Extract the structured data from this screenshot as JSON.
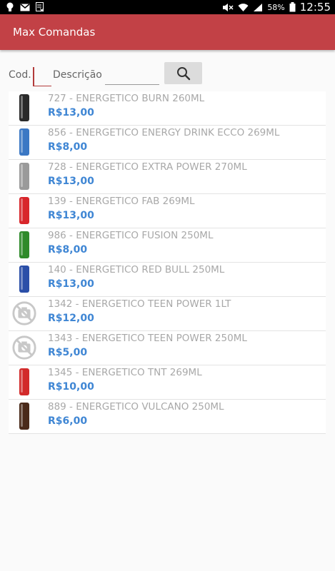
{
  "status_bar": {
    "time": "12:55",
    "battery_percent": "58%",
    "left_icons": [
      "lightbulb-icon",
      "mail-icon",
      "ocr-icon"
    ],
    "right_icons": [
      "mute-icon",
      "wifi-icon",
      "signal-icon",
      "battery-icon"
    ]
  },
  "app_bar": {
    "title": "Max Comandas",
    "color": "#c24146"
  },
  "filters": {
    "cod_label": "Cod.",
    "cod_value": "",
    "desc_label": "Descrição",
    "desc_value": "",
    "search_icon": "search-icon"
  },
  "products": [
    {
      "title": "727 - ENERGETICO BURN 260ML",
      "price": "R$13,00",
      "image": "can",
      "can_color": "#2a2a2a"
    },
    {
      "title": "856 - ENERGETICO ENERGY DRINK ECCO 269ML",
      "price": "R$8,00",
      "image": "can",
      "can_color": "#3b78c4"
    },
    {
      "title": "728 - ENERGETICO EXTRA POWER 270ML",
      "price": "R$13,00",
      "image": "can",
      "can_color": "#9a9a9a"
    },
    {
      "title": "139 - ENERGETICO FAB 269ML",
      "price": "R$13,00",
      "image": "can",
      "can_color": "#d8262b"
    },
    {
      "title": "986 - ENERGETICO FUSION 250ML",
      "price": "R$8,00",
      "image": "can",
      "can_color": "#2f8a2a"
    },
    {
      "title": "140 - ENERGETICO RED BULL 250ML",
      "price": "R$13,00",
      "image": "can",
      "can_color": "#2b4fa8"
    },
    {
      "title": "1342 - ENERGETICO TEEN POWER 1LT",
      "price": "R$12,00",
      "image": "no-photo"
    },
    {
      "title": "1343 - ENERGETICO TEEN POWER 250ML",
      "price": "R$5,00",
      "image": "no-photo"
    },
    {
      "title": "1345 - ENERGETICO TNT 269ML",
      "price": "R$10,00",
      "image": "can",
      "can_color": "#d22a2a"
    },
    {
      "title": "889 - ENERGETICO VULCANO 250ML",
      "price": "R$6,00",
      "image": "can",
      "can_color": "#4a2a1a"
    }
  ],
  "colors": {
    "price": "#3f86d4",
    "title": "#a8a8a8",
    "accent": "#c24146"
  }
}
